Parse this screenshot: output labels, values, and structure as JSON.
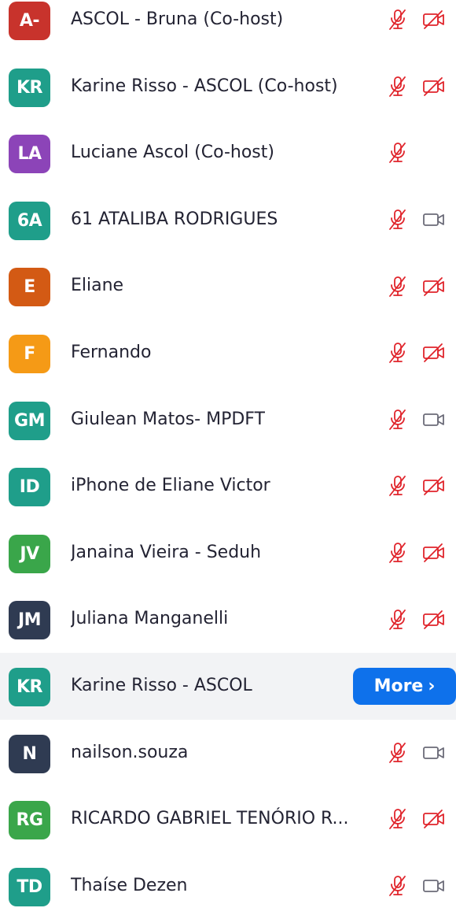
{
  "participants": [
    {
      "initials": "A-",
      "color": "#c8332c",
      "name": "ASCOL - Bruna (Co-host)",
      "mic": "muted",
      "video": "off"
    },
    {
      "initials": "KR",
      "color": "#1f9e8a",
      "name": "Karine Risso - ASCOL (Co-host)",
      "mic": "muted",
      "video": "off"
    },
    {
      "initials": "LA",
      "color": "#8c44b8",
      "name": "Luciane Ascol (Co-host)",
      "mic": "muted",
      "video": "none"
    },
    {
      "initials": "6A",
      "color": "#1f9e8a",
      "name": "61 ATALIBA RODRIGUES",
      "mic": "muted",
      "video": "on"
    },
    {
      "initials": "E",
      "color": "#d35a14",
      "name": "Eliane",
      "mic": "muted",
      "video": "off"
    },
    {
      "initials": "F",
      "color": "#f59a16",
      "name": "Fernando",
      "mic": "muted",
      "video": "off"
    },
    {
      "initials": "GM",
      "color": "#1f9e8a",
      "name": "Giulean Matos- MPDFT",
      "mic": "muted",
      "video": "on"
    },
    {
      "initials": "ID",
      "color": "#1f9e8a",
      "name": "iPhone de Eliane Victor",
      "mic": "muted",
      "video": "off"
    },
    {
      "initials": "JV",
      "color": "#3aa64a",
      "name": "Janaina Vieira - Seduh",
      "mic": "muted",
      "video": "off"
    },
    {
      "initials": "JM",
      "color": "#2f3b52",
      "name": "Juliana Manganelli",
      "mic": "muted",
      "video": "off"
    },
    {
      "initials": "KR",
      "color": "#1f9e8a",
      "name": "Karine Risso - ASCOL",
      "mic": "none",
      "video": "none",
      "hovered": true
    },
    {
      "initials": "N",
      "color": "#2f3b52",
      "name": "nailson.souza",
      "mic": "muted",
      "video": "on"
    },
    {
      "initials": "RG",
      "color": "#3aa64a",
      "name": "RICARDO GABRIEL TENÓRIO R...",
      "mic": "muted",
      "video": "off"
    },
    {
      "initials": "TD",
      "color": "#1f9e8a",
      "name": "Thaíse Dezen",
      "mic": "muted",
      "video": "on"
    }
  ],
  "more_button": {
    "label": "More",
    "chevron": "›"
  },
  "colors": {
    "muted_red": "#e0242b",
    "video_gray": "#6b6b78",
    "more_blue": "#0e71eb"
  }
}
